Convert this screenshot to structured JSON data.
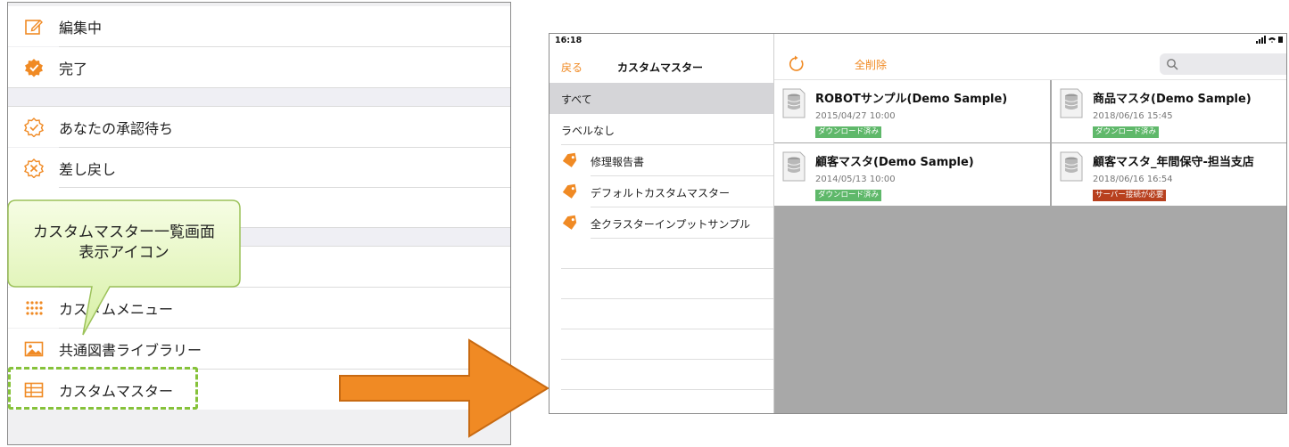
{
  "left_menu": {
    "items": [
      {
        "label": "編集中",
        "icon": "pencil-square-icon"
      },
      {
        "label": "完了",
        "icon": "check-badge-icon"
      },
      {
        "label": "あなたの承認待ち",
        "icon": "check-badge-outline-icon"
      },
      {
        "label": "差し戻し",
        "icon": "x-badge-outline-icon"
      },
      {
        "label": "カスタムメニュー",
        "icon": "grid-dots-icon"
      },
      {
        "label": "共通図書ライブラリー",
        "icon": "image-icon"
      },
      {
        "label": "カスタムマスター",
        "icon": "table-icon"
      }
    ]
  },
  "callout": {
    "line1": "カスタムマスター一覧画面",
    "line2": "表示アイコン"
  },
  "tablet": {
    "status": {
      "time": "16:18"
    },
    "sidebar": {
      "back_label": "戻る",
      "title": "カスタムマスター",
      "items": [
        {
          "label": "すべて",
          "selected": true
        },
        {
          "label": "ラベルなし"
        },
        {
          "label": "修理報告書",
          "tag": true
        },
        {
          "label": "デフォルトカスタムマスター",
          "tag": true
        },
        {
          "label": "全クラスターインプットサンプル",
          "tag": true
        }
      ]
    },
    "toolbar": {
      "delete_all_label": "全削除"
    },
    "cards": [
      {
        "title": "ROBOTサンプル(Demo Sample)",
        "date": "2015/04/27 10:00",
        "badge": "ダウンロード済み",
        "badge_color": "#5fb86a"
      },
      {
        "title": "商品マスタ(Demo Sample)",
        "date": "2018/06/16 15:45",
        "badge": "ダウンロード済み",
        "badge_color": "#5fb86a"
      },
      {
        "title": "顧客マスタ(Demo Sample)",
        "date": "2014/05/13 10:00",
        "badge": "ダウンロード済み",
        "badge_color": "#5fb86a"
      },
      {
        "title": "顧客マスタ_年間保守-担当支店",
        "date": "2018/06/16 16:54",
        "badge": "サーバー接続が必要",
        "badge_color": "#b8401e"
      }
    ]
  },
  "colors": {
    "accent": "#f08a24",
    "highlight": "#86c23a",
    "callout_fill": "#e8f7c4",
    "arrow": "#f08a24"
  }
}
